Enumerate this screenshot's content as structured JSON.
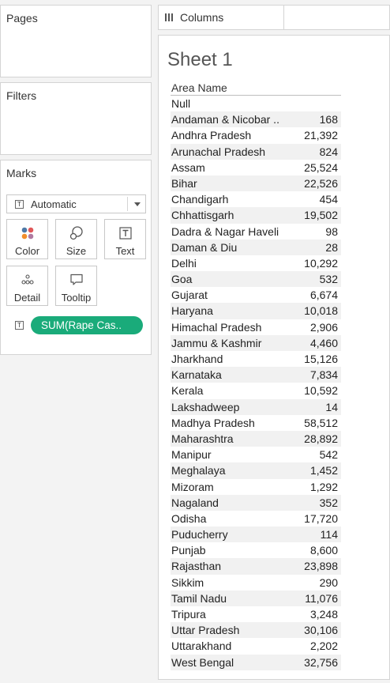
{
  "left_panel": {
    "pages_title": "Pages",
    "filters_title": "Filters",
    "marks_title": "Marks",
    "mark_type": "Automatic",
    "buttons": [
      {
        "label": "Color",
        "icon": "color-icon"
      },
      {
        "label": "Size",
        "icon": "size-icon"
      },
      {
        "label": "Text",
        "icon": "text-icon"
      },
      {
        "label": "Detail",
        "icon": "detail-icon"
      },
      {
        "label": "Tooltip",
        "icon": "tooltip-icon"
      }
    ],
    "pill_label": "SUM(Rape Cas.."
  },
  "columns_shelf": {
    "label": "Columns"
  },
  "sheet": {
    "title": "Sheet 1",
    "header": "Area Name",
    "rows": [
      {
        "name": "Null",
        "value": ""
      },
      {
        "name": "Andaman & Nicobar ..",
        "value": "168"
      },
      {
        "name": "Andhra Pradesh",
        "value": "21,392"
      },
      {
        "name": "Arunachal Pradesh",
        "value": "824"
      },
      {
        "name": "Assam",
        "value": "25,524"
      },
      {
        "name": "Bihar",
        "value": "22,526"
      },
      {
        "name": "Chandigarh",
        "value": "454"
      },
      {
        "name": "Chhattisgarh",
        "value": "19,502"
      },
      {
        "name": "Dadra & Nagar Haveli",
        "value": "98"
      },
      {
        "name": "Daman & Diu",
        "value": "28"
      },
      {
        "name": "Delhi",
        "value": "10,292"
      },
      {
        "name": "Goa",
        "value": "532"
      },
      {
        "name": "Gujarat",
        "value": "6,674"
      },
      {
        "name": "Haryana",
        "value": "10,018"
      },
      {
        "name": "Himachal Pradesh",
        "value": "2,906"
      },
      {
        "name": "Jammu & Kashmir",
        "value": "4,460"
      },
      {
        "name": "Jharkhand",
        "value": "15,126"
      },
      {
        "name": "Karnataka",
        "value": "7,834"
      },
      {
        "name": "Kerala",
        "value": "10,592"
      },
      {
        "name": "Lakshadweep",
        "value": "14"
      },
      {
        "name": "Madhya Pradesh",
        "value": "58,512"
      },
      {
        "name": "Maharashtra",
        "value": "28,892"
      },
      {
        "name": "Manipur",
        "value": "542"
      },
      {
        "name": "Meghalaya",
        "value": "1,452"
      },
      {
        "name": "Mizoram",
        "value": "1,292"
      },
      {
        "name": "Nagaland",
        "value": "352"
      },
      {
        "name": "Odisha",
        "value": "17,720"
      },
      {
        "name": "Puducherry",
        "value": "114"
      },
      {
        "name": "Punjab",
        "value": "8,600"
      },
      {
        "name": "Rajasthan",
        "value": "23,898"
      },
      {
        "name": "Sikkim",
        "value": "290"
      },
      {
        "name": "Tamil Nadu",
        "value": "11,076"
      },
      {
        "name": "Tripura",
        "value": "3,248"
      },
      {
        "name": "Uttar Pradesh",
        "value": "30,106"
      },
      {
        "name": "Uttarakhand",
        "value": "2,202"
      },
      {
        "name": "West Bengal",
        "value": "32,756"
      }
    ]
  },
  "colors": {
    "pill": "#1aab7a",
    "stripe": "#f1f1f1"
  }
}
